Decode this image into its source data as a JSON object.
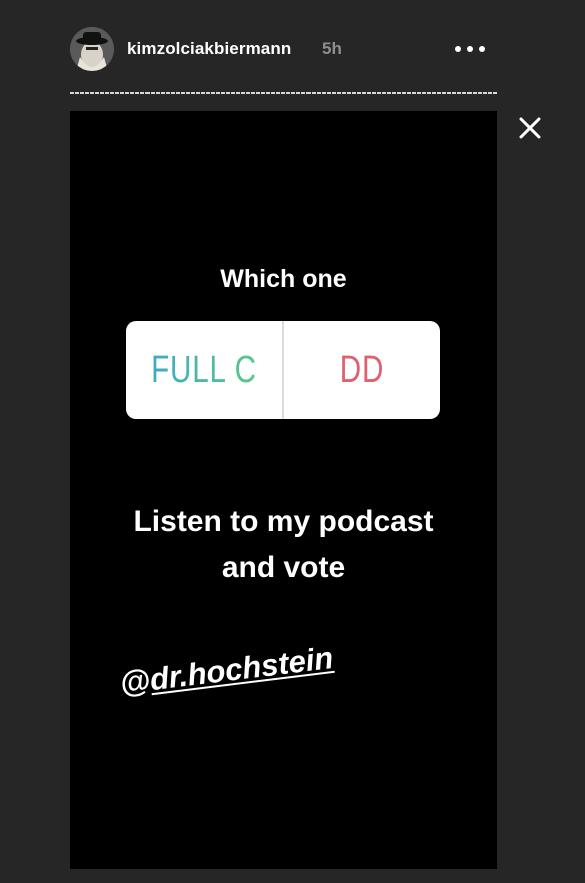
{
  "header": {
    "username": "kimzolciakbiermann",
    "timestamp": "5h",
    "more_icon": "more-horizontal-icon"
  },
  "progress": {
    "segments": 85,
    "viewed_segments": 85
  },
  "close_icon": "close-icon",
  "story": {
    "poll": {
      "question": "Which one",
      "option_a": "FULL C",
      "option_b": "DD"
    },
    "caption_line1": "Listen to my podcast",
    "caption_line2": "and vote",
    "mention": {
      "at": "@",
      "handle": "dr.hochstein"
    }
  },
  "colors": {
    "background": "#262626",
    "story_background": "#000000",
    "option_a_gradient_start": "#3aa8c8",
    "option_a_gradient_end": "#5ec985",
    "option_b": "#e0606e",
    "timestamp": "#8e8e8e"
  }
}
